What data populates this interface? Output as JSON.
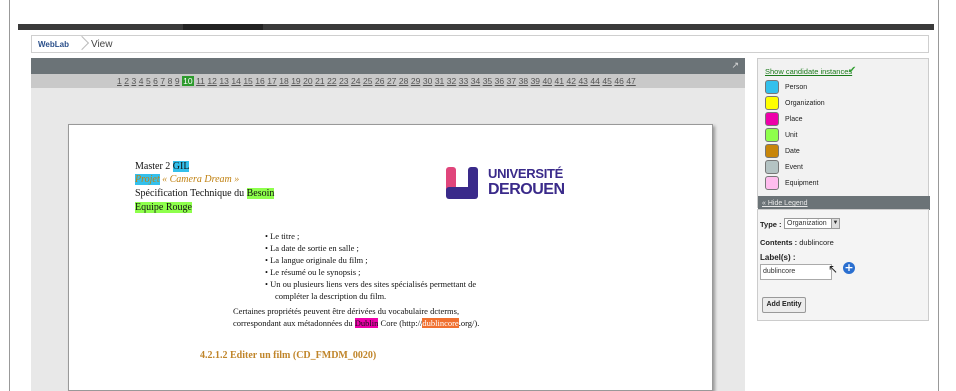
{
  "breadcrumb": {
    "home": "WebLab",
    "current": "View"
  },
  "page_nav": {
    "pages": [
      "1",
      "2",
      "3",
      "4",
      "5",
      "6",
      "7",
      "8",
      "9",
      "10",
      "11",
      "12",
      "13",
      "14",
      "15",
      "16",
      "17",
      "18",
      "19",
      "20",
      "21",
      "22",
      "23",
      "24",
      "25",
      "26",
      "27",
      "28",
      "29",
      "30",
      "31",
      "32",
      "33",
      "34",
      "35",
      "36",
      "37",
      "38",
      "39",
      "40",
      "41",
      "42",
      "43",
      "44",
      "45",
      "46",
      "47"
    ],
    "current": "10"
  },
  "document": {
    "line1_prefix": "Master 2 ",
    "line1_hl": "GIL",
    "line2_hl": "Projet",
    "line2_rest": " « Camera Dream »",
    "line3_prefix": "Spécification Technique du ",
    "line3_hl": "Besoin",
    "line4_hl": "Equipe Rouge",
    "logo_line1": "UNIVERSITÉ",
    "logo_line2": "DEROUEN",
    "bullets": [
      "Le titre ;",
      "La date de sortie en salle ;",
      "La langue originale du film ;",
      "Le résumé ou le synopsis ;",
      "Un ou plusieurs liens vers des sites spécialisés permettant de",
      "compléter la description du film."
    ],
    "para_line1": "Certaines propriétés peuvent être dérivées du vocabulaire dcterms,",
    "para_line2_a": "correspondant aux métadonnées du ",
    "para_line2_hl1": "Dublin",
    "para_line2_b": " Core (http://",
    "para_line2_hl2": "dublincore",
    "para_line2_c": ".org/).",
    "section_title": "4.2.1.2 Editer un film (CD_FMDM_0020)"
  },
  "legend": {
    "show_link": "Show candidate instances",
    "items": [
      {
        "label": "Person",
        "color": "#33c0ec"
      },
      {
        "label": "Organization",
        "color": "#ffff00"
      },
      {
        "label": "Place",
        "color": "#ee00aa"
      },
      {
        "label": "Unit",
        "color": "#8eff4c"
      },
      {
        "label": "Date",
        "color": "#c8860a"
      },
      {
        "label": "Event",
        "color": "#b4c3c3"
      },
      {
        "label": "Equipment",
        "color": "#ffbdee"
      }
    ],
    "hide_link": "« Hide Legend"
  },
  "entity": {
    "type_label": "Type :",
    "type_value": "Organization",
    "contents_label": "Contents :",
    "contents_value": "dublincore",
    "labels_label": "Label(s) :",
    "label_input_value": "dublincore",
    "add_button": "Add Entity"
  }
}
